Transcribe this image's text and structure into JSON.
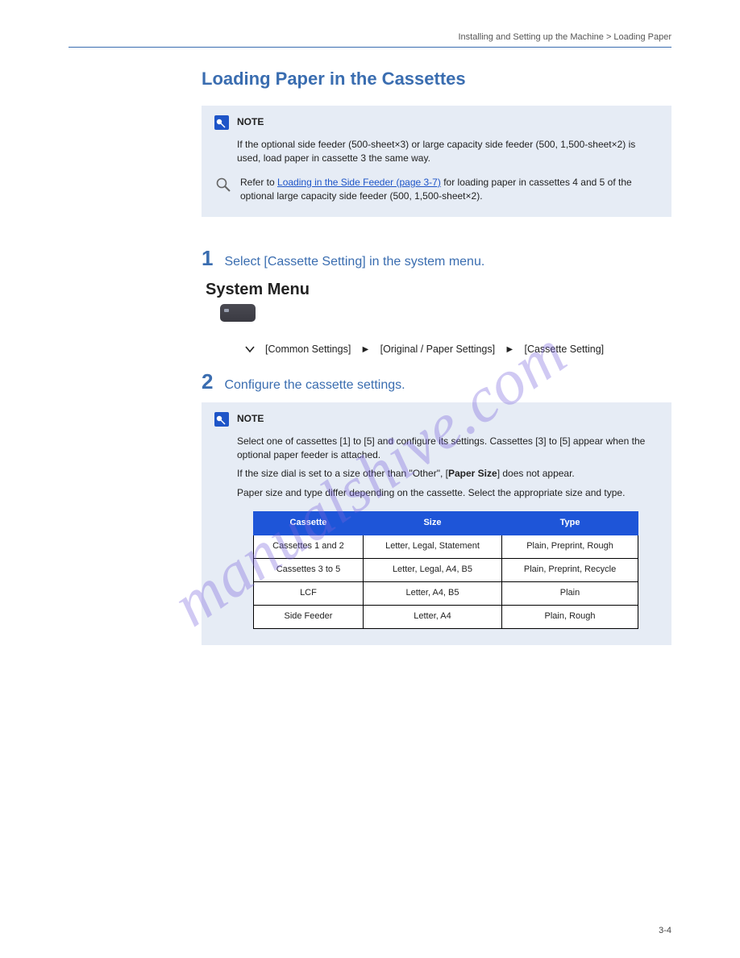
{
  "header": {
    "running": "Installing and Setting up the Machine > Loading Paper"
  },
  "section_title": "Loading Paper in the Cassettes",
  "note1": {
    "label": "NOTE",
    "text": "If the optional side feeder (500-sheet×3) or large capacity side feeder (500, 1,500-sheet×2) is used, load paper in cassette 3 the same way.",
    "ref_link": "Loading in the Side Feeder (page 3-7)",
    "ref_tail": "for loading paper in cassettes 4 and 5 of the optional large capacity side feeder (500, 1,500-sheet×2)."
  },
  "step1": {
    "num": "1",
    "text": "Select [Cassette Setting] in the system menu."
  },
  "sysmenu": {
    "label": "System Menu",
    "path_items": [
      "[Common Settings]",
      "[Original / Paper Settings]",
      "[Cassette Setting]"
    ]
  },
  "step2": {
    "num": "2",
    "text": "Configure the cassette settings."
  },
  "note2": {
    "label": "NOTE",
    "line1": "Select one of cassettes [1] to [5] and configure its settings. Cassettes [3] to [5] appear when the optional paper feeder is attached.",
    "line2": "If the size dial is set to a size other than \"Other\", [",
    "line2_mid": "Paper Size",
    "line2_tail": "] does not appear.",
    "line3": "Paper size and type differ depending on the cassette. Select the appropriate size and type."
  },
  "table": {
    "headers": [
      "Cassette",
      "Size",
      "Type"
    ],
    "rows": [
      [
        "Cassettes 1 and 2",
        "Letter, Legal, Statement",
        "Plain, Preprint, Rough"
      ],
      [
        "Cassettes 3 to 5",
        "Letter, Legal, A4, B5",
        "Plain, Preprint, Recycle"
      ],
      [
        "LCF",
        "Letter, A4, B5",
        "Plain"
      ],
      [
        "Side Feeder",
        "Letter, A4",
        "Plain, Rough"
      ]
    ]
  },
  "page_number": "3-4",
  "watermark": "manualshive.com"
}
